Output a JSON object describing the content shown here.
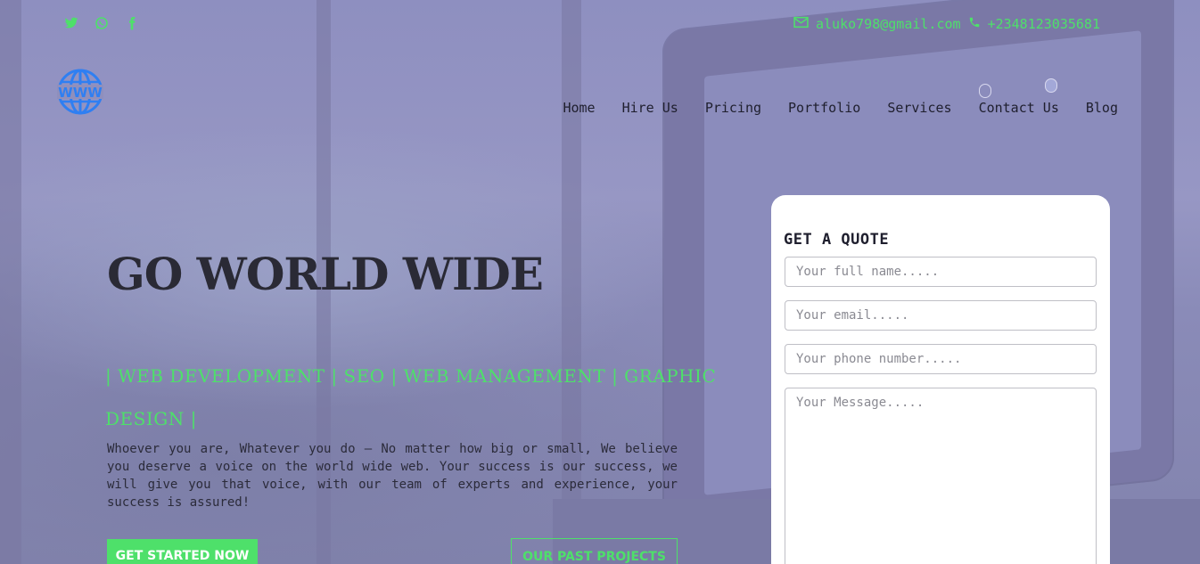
{
  "top_bar": {
    "social": [
      {
        "name": "twitter",
        "glyph": "🐦"
      },
      {
        "name": "whatsapp",
        "glyph": "◎"
      },
      {
        "name": "facebook",
        "glyph": "f"
      }
    ],
    "email": "aluko798@gmail.com",
    "phone": "+2348123035681"
  },
  "logo": {
    "text": "WWW"
  },
  "nav": {
    "items": [
      "Home",
      "Hire Us",
      "Pricing",
      "Portfolio",
      "Services",
      "Contact Us",
      "Blog"
    ]
  },
  "hero": {
    "title": "GO WORLD WIDE",
    "services_line": "| WEB DEVELOPMENT | SEO | WEB MANAGEMENT | GRAPHIC DESIGN |",
    "description": "Whoever you are, Whatever you do – No matter how big or small, We believe you deserve a voice on the world wide web. Your success is our success, we will give you that voice, with our team of experts and experience, your success is assured!",
    "primary_button": "GET STARTED NOW",
    "secondary_button": "OUR PAST PROJECTS"
  },
  "quote_form": {
    "title": "GET A QUOTE",
    "name_placeholder": "Your full name.....",
    "email_placeholder": "Your email.....",
    "phone_placeholder": "Your phone number.....",
    "message_placeholder": "Your Message....."
  },
  "colors": {
    "accent": "#4ee06a",
    "overlay": "#8f8fbc",
    "text_dark": "#2a2a35"
  }
}
